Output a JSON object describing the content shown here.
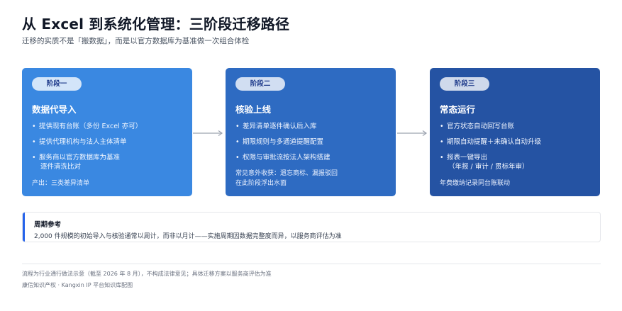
{
  "header": {
    "title": "从 Excel 到系统化管理：三阶段迁移路径",
    "subtitle": "迁移的实质不是「搬数据」，而是以官方数据库为基准做一次组合体检"
  },
  "stages": [
    {
      "badge": "阶段一",
      "title": "数据代导入",
      "items": [
        [
          "提供现有台账（多份 Excel 亦可）"
        ],
        [
          "提供代理机构与法人主体清单"
        ],
        [
          "服务商以官方数据库为基准",
          "逐件清洗比对"
        ]
      ],
      "note": "产出：三类差异清单",
      "color": "#3a88e1"
    },
    {
      "badge": "阶段二",
      "title": "核验上线",
      "items": [
        [
          "差异清单逐件确认后入库"
        ],
        [
          "期限规则与多通道提醒配置"
        ],
        [
          "权限与审批流按法人架构搭建"
        ]
      ],
      "note": "常见意外收获：遗忘商标、漏报驳回\n在此阶段浮出水面",
      "color": "#2e6bc2"
    },
    {
      "badge": "阶段三",
      "title": "常态运行",
      "items": [
        [
          "官方状态自动回写台账"
        ],
        [
          "期限自动提醒＋未确认自动升级"
        ],
        [
          "报表一键导出",
          "（年报 / 审计 / 贯标年审）"
        ]
      ],
      "note": "年费缴纳记录同台账联动",
      "color": "#2553a3"
    }
  ],
  "cycle": {
    "title": "周期参考",
    "body": "2,000 件规模的初始导入与核验通常以周计，而非以月计——实施周期因数据完整度而异，以服务商评估为准"
  },
  "footer": {
    "line1": "流程为行业通行做法示意（截至 2026 年 8 月），不构成法律意见；具体迁移方案以服务商评估为准",
    "line2": "康信知识产权 · Kangxin IP 平台知识库配图"
  },
  "colors": {
    "accent": "#2563eb",
    "arrow": "#9ca3af"
  }
}
